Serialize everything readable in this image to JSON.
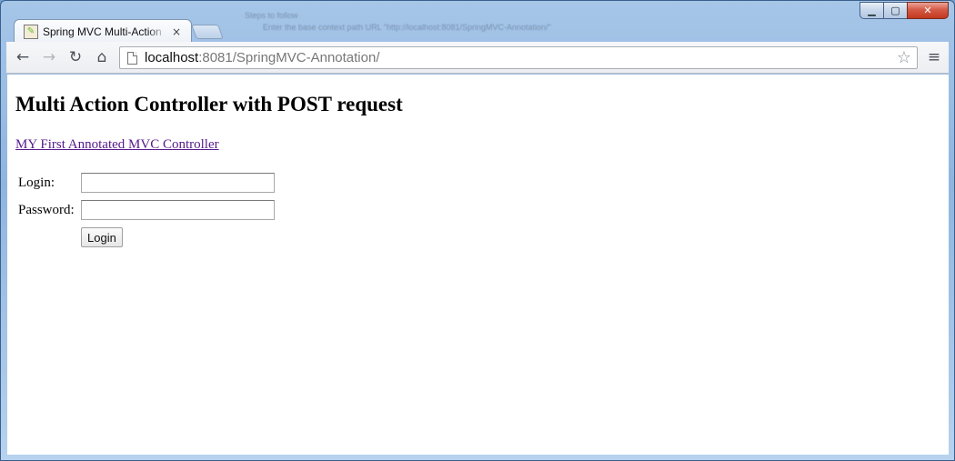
{
  "browser": {
    "tab_title": "Spring MVC Multi-Action",
    "tab_close": "×",
    "url_host": "localhost",
    "url_rest": ":8081/SpringMVC-Annotation/",
    "window_controls": {
      "minimize": "▁",
      "maximize": "▢",
      "close": "✕"
    },
    "nav": {
      "back": "←",
      "forward": "→",
      "reload": "↻",
      "home": "⌂",
      "bookmark": "☆",
      "menu": "≡"
    },
    "background_window_text": [
      "Steps to follow",
      "Enter the base context path URL \"http://localhost:8081/SpringMVC-Annotation/\""
    ]
  },
  "page": {
    "heading": "Multi Action Controller with POST request",
    "link_text": "MY First Annotated MVC Controller",
    "form": {
      "login_label": "Login:",
      "login_value": "",
      "password_label": "Password:",
      "password_value": "",
      "submit_label": "Login"
    }
  },
  "colors": {
    "visited_link": "#551a8b",
    "window_frame": "#8fb5df"
  }
}
